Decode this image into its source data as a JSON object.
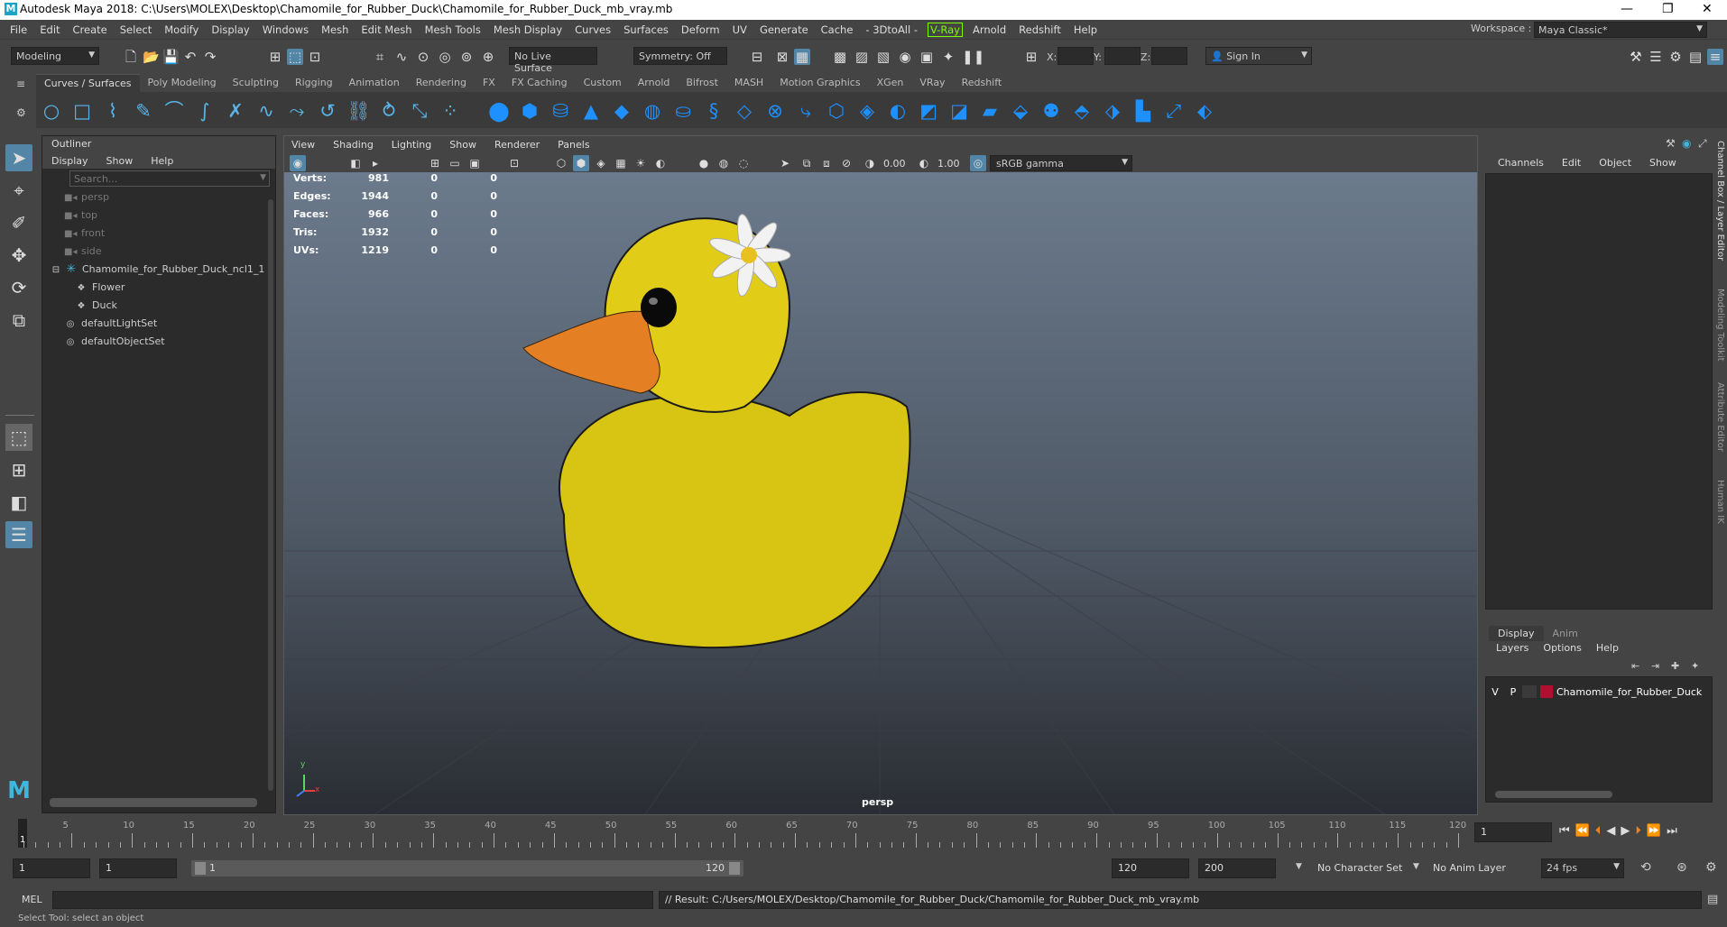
{
  "window": {
    "title": "Autodesk Maya 2018: C:\\Users\\MOLEX\\Desktop\\Chamomile_for_Rubber_Duck\\Chamomile_for_Rubber_Duck_mb_vray.mb",
    "logo": "M",
    "minimize": "—",
    "restore": "❐",
    "close": "✕"
  },
  "menubar": {
    "items": [
      "File",
      "Edit",
      "Create",
      "Select",
      "Modify",
      "Display",
      "Windows",
      "Mesh",
      "Edit Mesh",
      "Mesh Tools",
      "Mesh Display",
      "Curves",
      "Surfaces",
      "Deform",
      "UV",
      "Generate",
      "Cache",
      "- 3DtoAll -"
    ],
    "vray": "V-Ray",
    "items2": [
      "Arnold",
      "Redshift",
      "Help"
    ],
    "workspace_label": "Workspace :",
    "workspace_value": "Maya Classic*"
  },
  "statusline": {
    "mode": "Modeling",
    "live_surface": "No Live Surface",
    "symmetry": "Symmetry: Off",
    "x_label": "X:",
    "y_label": "Y:",
    "z_label": "Z:",
    "signin": "Sign In"
  },
  "shelf": {
    "tabs": [
      "Curves / Surfaces",
      "Poly Modeling",
      "Sculpting",
      "Rigging",
      "Animation",
      "Rendering",
      "FX",
      "FX Caching",
      "Custom",
      "Arnold",
      "Bifrost",
      "MASH",
      "Motion Graphics",
      "XGen",
      "VRay",
      "Redshift"
    ],
    "active_tab": "Curves / Surfaces"
  },
  "outliner": {
    "title": "Outliner",
    "menu": [
      "Display",
      "Show",
      "Help"
    ],
    "search_placeholder": "Search...",
    "items": [
      {
        "label": "persp",
        "icon": "camera-icon",
        "dim": true,
        "level": 1
      },
      {
        "label": "top",
        "icon": "camera-icon",
        "dim": true,
        "level": 1
      },
      {
        "label": "front",
        "icon": "camera-icon",
        "dim": true,
        "level": 1
      },
      {
        "label": "side",
        "icon": "camera-icon",
        "dim": true,
        "level": 1
      },
      {
        "label": "Chamomile_for_Rubber_Duck_ncl1_1",
        "icon": "group-icon",
        "dim": false,
        "level": 0
      },
      {
        "label": "Flower",
        "icon": "mesh-icon",
        "dim": false,
        "level": 2
      },
      {
        "label": "Duck",
        "icon": "mesh-icon",
        "dim": false,
        "level": 2
      },
      {
        "label": "defaultLightSet",
        "icon": "set-icon",
        "dim": false,
        "level": 1
      },
      {
        "label": "defaultObjectSet",
        "icon": "set-icon",
        "dim": false,
        "level": 1
      }
    ]
  },
  "viewport": {
    "menu": [
      "View",
      "Shading",
      "Lighting",
      "Show",
      "Renderer",
      "Panels"
    ],
    "exposure": "0.00",
    "gamma": "1.00",
    "colorspace": "sRGB gamma",
    "camera_label": "persp",
    "hud": [
      {
        "label": "Verts:",
        "v1": "981",
        "v2": "0",
        "v3": "0"
      },
      {
        "label": "Edges:",
        "v1": "1944",
        "v2": "0",
        "v3": "0"
      },
      {
        "label": "Faces:",
        "v1": "966",
        "v2": "0",
        "v3": "0"
      },
      {
        "label": "Tris:",
        "v1": "1932",
        "v2": "0",
        "v3": "0"
      },
      {
        "label": "UVs:",
        "v1": "1219",
        "v2": "0",
        "v3": "0"
      }
    ],
    "axis_y": "y",
    "axis_x": "x"
  },
  "channelbox": {
    "menu": [
      "Channels",
      "Edit",
      "Object",
      "Show"
    ]
  },
  "layers": {
    "tabs": [
      "Display",
      "Anim"
    ],
    "menu": [
      "Layers",
      "Options",
      "Help"
    ],
    "row": {
      "v": "V",
      "p": "P",
      "name": "Chamomile_for_Rubber_Duck",
      "color": "#b01030"
    }
  },
  "rightstrip": {
    "labels": [
      "Channel Box / Layer Editor",
      "Modeling Toolkit",
      "Attribute Editor",
      "Human IK"
    ]
  },
  "timeslider": {
    "ticks": [
      "5",
      "10",
      "15",
      "20",
      "25",
      "30",
      "35",
      "40",
      "45",
      "50",
      "55",
      "60",
      "65",
      "70",
      "75",
      "80",
      "85",
      "90",
      "95",
      "100",
      "105",
      "110",
      "115",
      "120"
    ],
    "current_marker": "1",
    "current_frame": "1"
  },
  "range": {
    "start": "1",
    "playback_start": "1",
    "slider_start": "1",
    "slider_end": "120",
    "playback_end": "120",
    "end": "200",
    "character_set": "No Character Set",
    "anim_layer": "No Anim Layer",
    "fps": "24 fps"
  },
  "cmdline": {
    "label": "MEL",
    "result": "// Result: C:/Users/MOLEX/Desktop/Chamomile_for_Rubber_Duck/Chamomile_for_Rubber_Duck_mb_vray.mb"
  },
  "helpline": {
    "text": "Select Tool: select an object"
  },
  "colors": {
    "accent": "#5285a6",
    "duck": "#e6d21a",
    "beak": "#e8832a"
  }
}
